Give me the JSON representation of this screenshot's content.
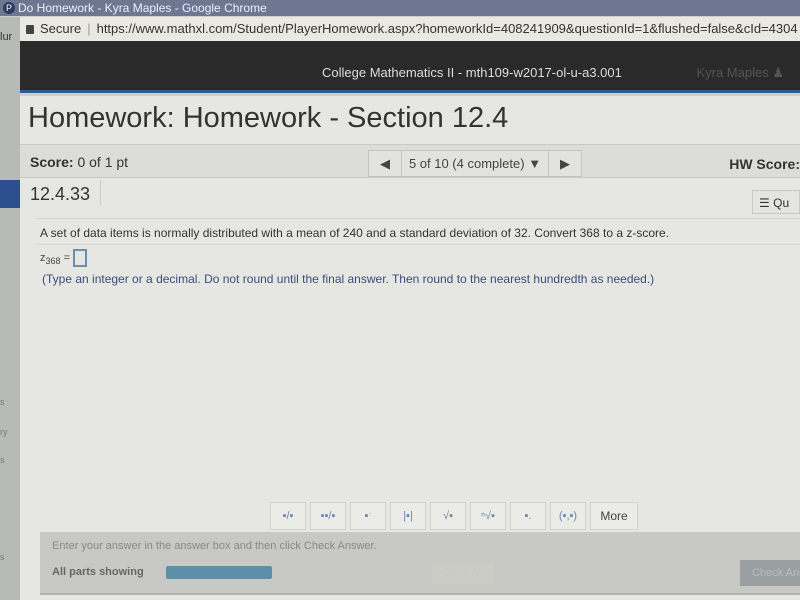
{
  "browser": {
    "window_title": "Do Homework - Kyra Maples - Google Chrome",
    "secure_label": "Secure",
    "url": "https://www.mathxl.com/Student/PlayerHomework.aspx?homeworkId=408241909&questionId=1&flushed=false&cId=4304"
  },
  "sidebar": {
    "fragments": [
      "lur",
      "s",
      "ry",
      "s",
      "s"
    ]
  },
  "header": {
    "course": "College Mathematics II - mth109-w2017-ol-u-a3.001",
    "user": "Kyra Maples"
  },
  "page": {
    "title": "Homework: Homework - Section 12.4"
  },
  "scorebar": {
    "score_label": "Score:",
    "score_value": "0 of 1 pt",
    "nav_status": "5 of 10 (4 complete)",
    "hw_score_label": "HW Score:"
  },
  "question": {
    "id": "12.4.33",
    "side_button": "Qu",
    "text": "A set of data items is normally distributed with a mean of 240 and a standard deviation of 32. Convert 368 to a z-score.",
    "var": "z",
    "sub": "368",
    "eq": "=",
    "hint": "(Type an integer or a decimal. Do not round until the final answer. Then round to the nearest hundredth as needed.)"
  },
  "toolbar": {
    "buttons": [
      "fraction",
      "mixed-number",
      "exponent",
      "absolute-value",
      "square-root",
      "nth-root",
      "subscript",
      "ordered-pair"
    ],
    "glyphs": [
      "▪/▪",
      "▪▪/▪",
      "▪ˑ",
      "|▪|",
      "√▪",
      "ⁿ√▪",
      "▪.",
      "(▪,▪)"
    ],
    "more": "More"
  },
  "footer": {
    "instruction": "Enter your answer in the answer box and then click Check Answer.",
    "parts": "All parts showing",
    "progress": 1.0,
    "clear_all": "Clear All",
    "check_answer": "Check Answer"
  }
}
